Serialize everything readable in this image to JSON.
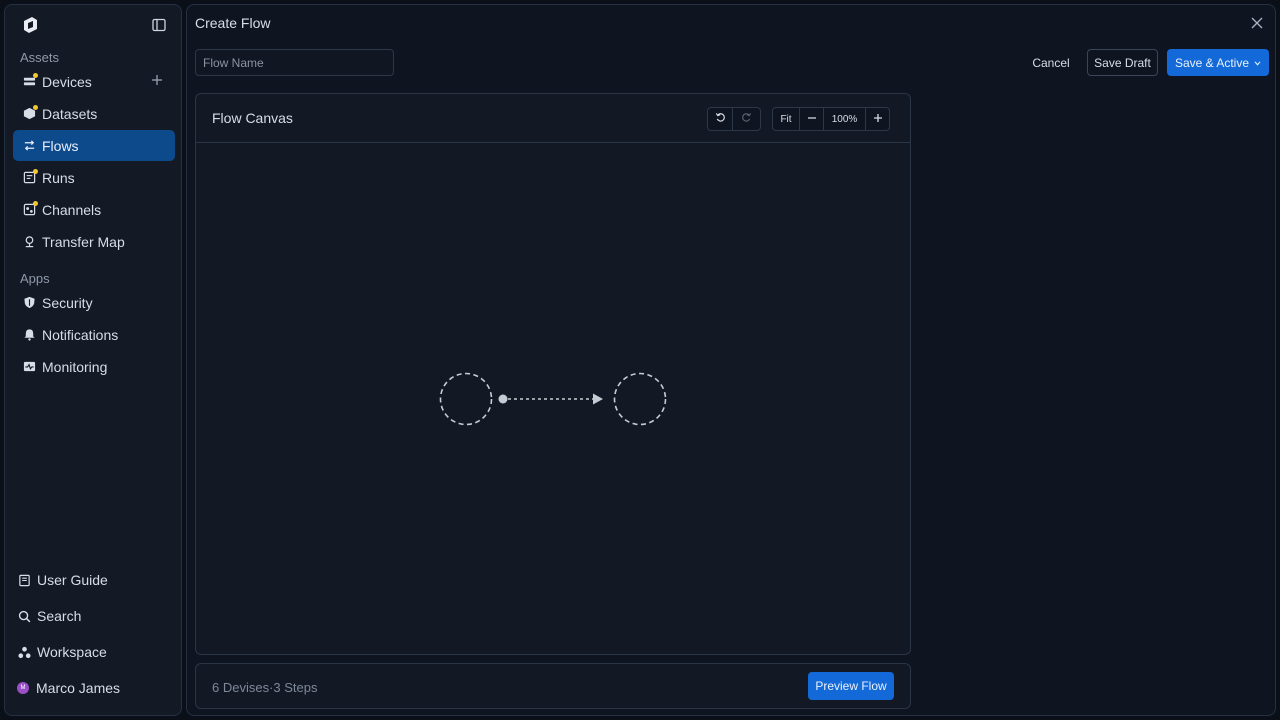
{
  "sidebar": {
    "assets_label": "Assets",
    "apps_label": "Apps",
    "asset_items": [
      {
        "label": "Devices",
        "icon": "devices-icon",
        "badge": true
      },
      {
        "label": "Datasets",
        "icon": "datasets-icon",
        "badge": true
      },
      {
        "label": "Flows",
        "icon": "flows-icon",
        "active": true
      },
      {
        "label": "Runs",
        "icon": "runs-icon",
        "badge": true
      },
      {
        "label": "Channels",
        "icon": "channels-icon",
        "badge": true
      },
      {
        "label": "Transfer Map",
        "icon": "map-pin-icon"
      }
    ],
    "app_items": [
      {
        "label": "Security",
        "icon": "shield-icon"
      },
      {
        "label": "Notifications",
        "icon": "bell-icon"
      },
      {
        "label": "Monitoring",
        "icon": "monitor-icon"
      }
    ],
    "bottom_items": [
      {
        "label": "User Guide",
        "icon": "book-icon"
      },
      {
        "label": "Search",
        "icon": "search-icon"
      },
      {
        "label": "Workspace",
        "icon": "workspace-icon"
      }
    ],
    "user": {
      "name": "Marco James",
      "initial": "M"
    }
  },
  "header": {
    "title": "Create Flow",
    "flow_name_placeholder": "Flow Name",
    "cancel_label": "Cancel",
    "save_draft_label": "Save Draft",
    "save_active_label": "Save & Active"
  },
  "canvas": {
    "title": "Flow Canvas",
    "fit_label": "Fit",
    "zoom_label": "100%"
  },
  "footer": {
    "devices": "6 Devises",
    "separator": "·",
    "steps": "3 Steps",
    "preview_label": "Preview Flow"
  },
  "colors": {
    "accent": "#1469d8",
    "active_nav": "#0d4a8c",
    "badge": "#f3c530",
    "avatar": "#9b4fc7"
  }
}
